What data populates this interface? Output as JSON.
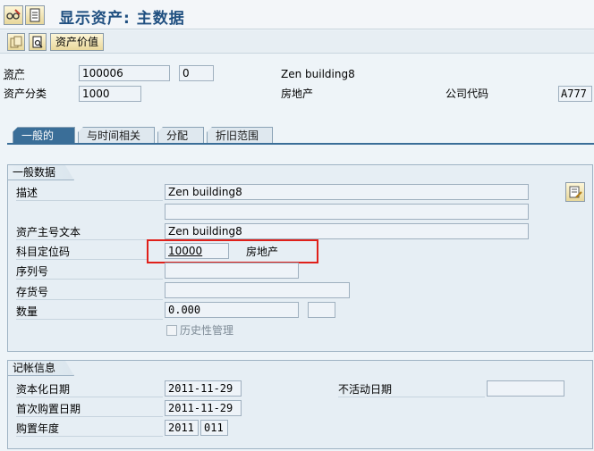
{
  "header": {
    "title": "显示资产: 主数据"
  },
  "toolbar": {
    "asset_value_label": "资产价值"
  },
  "asset_header": {
    "asset_label": "资产",
    "asset_number": "100006",
    "asset_subnumber": "0",
    "asset_description": "Zen building8",
    "asset_class_label": "资产分类",
    "asset_class": "1000",
    "asset_class_desc": "房地产",
    "company_code_label": "公司代码",
    "company_code": "A777"
  },
  "tabs": [
    {
      "label": "一般的",
      "active": true
    },
    {
      "label": "与时间相关",
      "active": false
    },
    {
      "label": "分配",
      "active": false
    },
    {
      "label": "折旧范围",
      "active": false
    }
  ],
  "general_data": {
    "title": "一般数据",
    "description_label": "描述",
    "description_1": "Zen building8",
    "description_2": "",
    "main_text_label": "资产主号文本",
    "main_text": "Zen building8",
    "acct_det_label": "科目定位码",
    "acct_det_value": "10000",
    "acct_det_desc": "房地产",
    "serial_label": "序列号",
    "serial_value": "",
    "inventory_label": "存货号",
    "inventory_value": "",
    "quantity_label": "数量",
    "quantity_value": "0.000",
    "quantity_unit": "",
    "history_label": "历史性管理"
  },
  "posting_info": {
    "title": "记帐信息",
    "cap_date_label": "资本化日期",
    "cap_date": "2011-11-29",
    "first_acq_label": "首次购置日期",
    "first_acq": "2011-11-29",
    "acq_year_label": "购置年度",
    "acq_year": "2011",
    "acq_period": "011",
    "deact_label": "不活动日期",
    "deact_date": ""
  }
}
